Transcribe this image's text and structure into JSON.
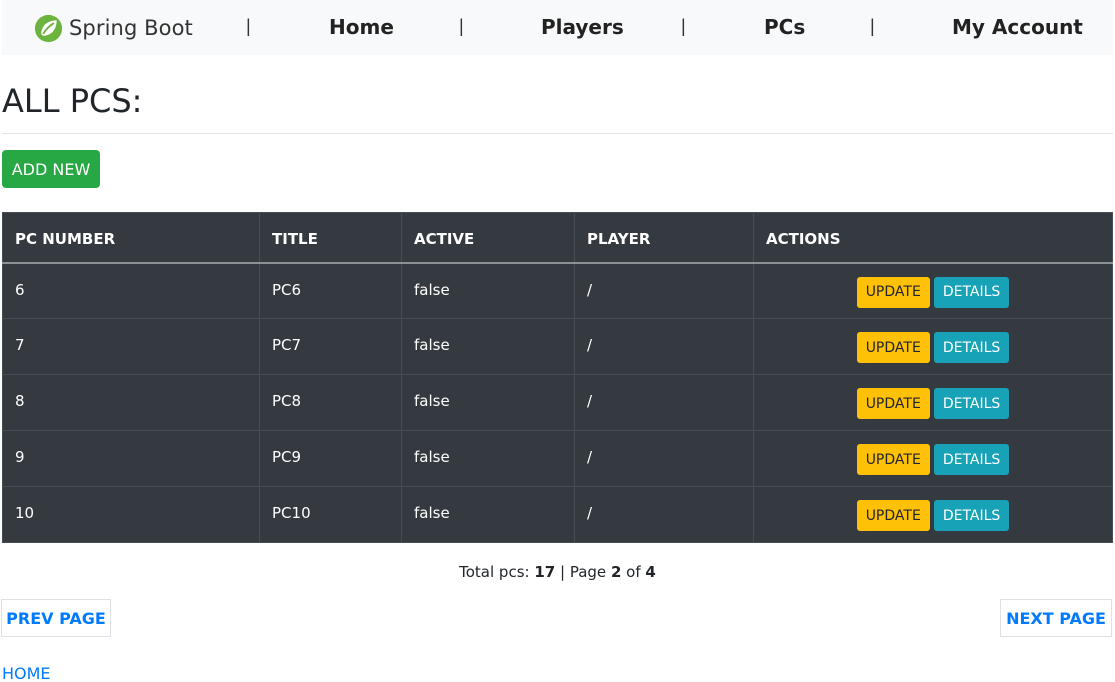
{
  "navbar": {
    "brand_text": "Spring Boot",
    "brand_icon": "spring-leaf-icon",
    "brand_color": "#6db33f",
    "separator": "|",
    "links": [
      "Home",
      "Players",
      "PCs",
      "My Account"
    ]
  },
  "page": {
    "title": "ALL PCS:",
    "add_button": "ADD NEW"
  },
  "table": {
    "headers": [
      "PC NUMBER",
      "TITLE",
      "ACTIVE",
      "PLAYER",
      "ACTIONS"
    ],
    "rows": [
      {
        "number": "6",
        "title": "PC6",
        "active": "false",
        "player": "/"
      },
      {
        "number": "7",
        "title": "PC7",
        "active": "false",
        "player": "/"
      },
      {
        "number": "8",
        "title": "PC8",
        "active": "false",
        "player": "/"
      },
      {
        "number": "9",
        "title": "PC9",
        "active": "false",
        "player": "/"
      },
      {
        "number": "10",
        "title": "PC10",
        "active": "false",
        "player": "/"
      }
    ],
    "update_label": "UPDATE",
    "details_label": "DETAILS"
  },
  "pagination": {
    "total_label": "Total pcs:",
    "total": "17",
    "divider": "|",
    "page_label": "Page",
    "page": "2",
    "of_label": "of",
    "pages": "4",
    "prev_label": "PREV PAGE",
    "next_label": "NEXT PAGE"
  },
  "footer": {
    "home_label": "HOME"
  },
  "colors": {
    "success": "#28a745",
    "warning": "#ffc107",
    "info": "#17a2b8",
    "link": "#007bff",
    "table_dark": "#343a40"
  }
}
